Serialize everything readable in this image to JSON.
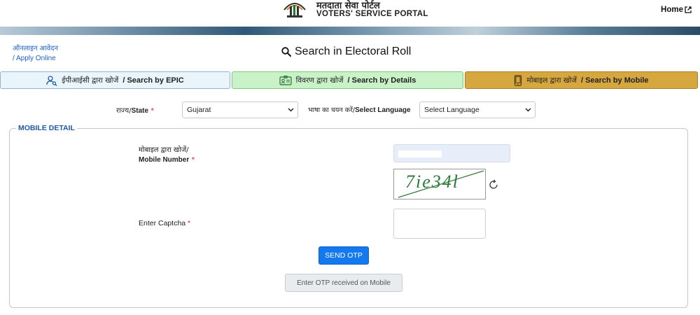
{
  "header": {
    "portal_hindi": "मतदाता सेवा पोर्टल",
    "portal_english": "VOTERS' SERVICE PORTAL",
    "home_label": "Home"
  },
  "apply": {
    "line1": "ऑनलाइन आवेदन",
    "line2": "/ Apply Online"
  },
  "page_title": "Search in Electoral Roll",
  "tabs": [
    {
      "hindi": "ईपीआईसी द्वारा खोजें",
      "english": "/ Search by EPIC",
      "icon": "user-search-icon",
      "active": false
    },
    {
      "hindi": "विवरण द्वारा खोजें",
      "english": "/ Search by Details",
      "icon": "id-card-icon",
      "active": false
    },
    {
      "hindi": "मोबाइल द्वारा खोजें",
      "english": "/ Search by Mobile",
      "icon": "mobile-phone-icon",
      "active": true
    }
  ],
  "filters": {
    "state_label_hindi": "राज्य/",
    "state_label_english": "State",
    "state_value": "Gujarat",
    "language_label_hindi": "भाषा का चयन करें/",
    "language_label_english": "Select Language",
    "language_value": "Select Language"
  },
  "mobile_detail": {
    "legend": "MOBILE DETAIL",
    "mobile_label_hindi": "मोबाइल द्वारा खोजें/",
    "mobile_label_english": "Mobile Number",
    "required_mark": "*",
    "captcha_text": "7ie34l",
    "captcha_label": "Enter Captcha",
    "send_otp_label": "SEND OTP",
    "otp_placeholder": "Enter OTP received on Mobile"
  },
  "colors": {
    "epic_tab_bg": "#e9f5fb",
    "details_tab_bg": "#c9f2c9",
    "mobile_tab_bg": "#d7a73f",
    "primary_button": "#1479ef",
    "legend_blue": "#1f5aa8",
    "required_red": "#e0242f"
  }
}
